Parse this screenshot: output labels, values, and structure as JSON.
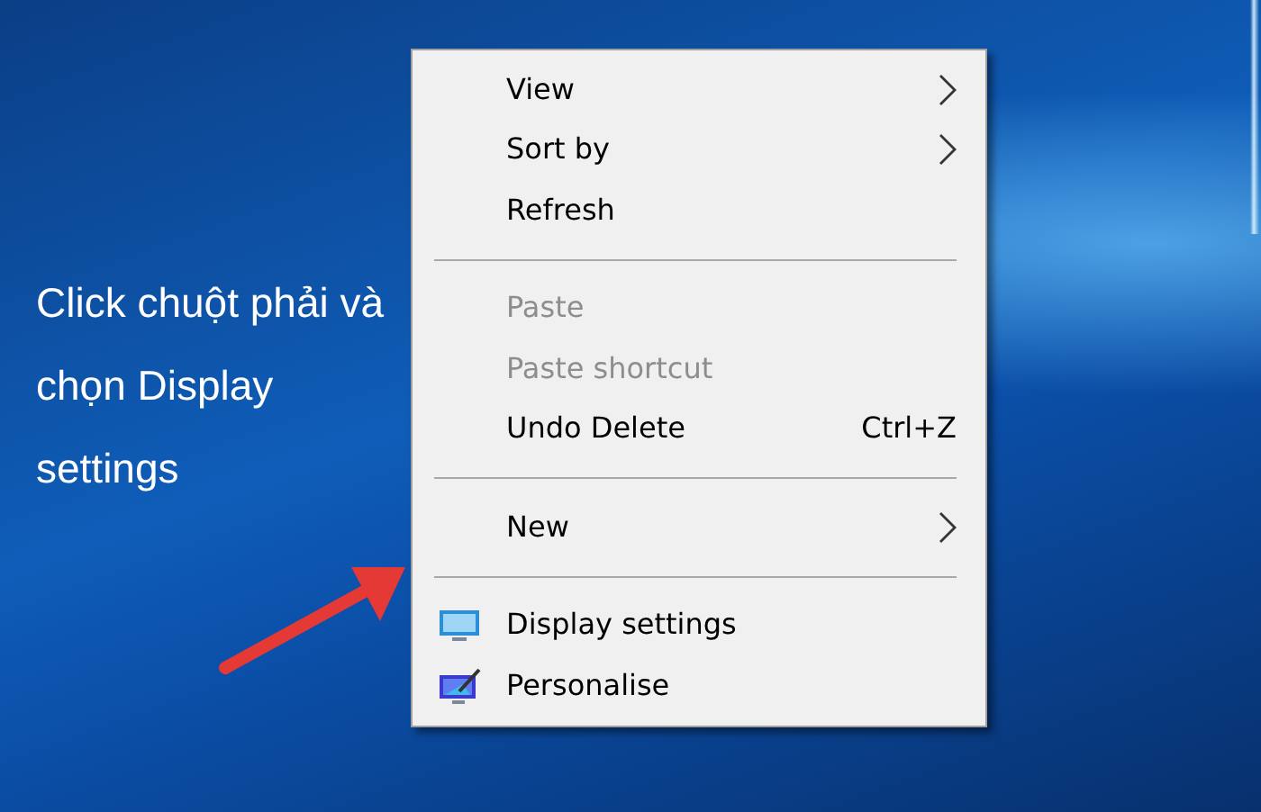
{
  "caption": "Click chuột phải và chọn Display settings",
  "menu": {
    "items": [
      {
        "kind": "submenu",
        "label": "View",
        "disabled": false
      },
      {
        "kind": "submenu",
        "label": "Sort by",
        "disabled": false
      },
      {
        "kind": "command",
        "label": "Refresh",
        "disabled": false
      },
      {
        "kind": "separator"
      },
      {
        "kind": "command",
        "label": "Paste",
        "disabled": true
      },
      {
        "kind": "command",
        "label": "Paste shortcut",
        "disabled": true
      },
      {
        "kind": "command",
        "label": "Undo Delete",
        "disabled": false,
        "shortcut": "Ctrl+Z"
      },
      {
        "kind": "separator"
      },
      {
        "kind": "submenu",
        "label": "New",
        "disabled": false
      },
      {
        "kind": "separator"
      },
      {
        "kind": "monitor-command",
        "label": "Display settings",
        "disabled": false
      },
      {
        "kind": "paint-command",
        "label": "Personalise",
        "disabled": false
      }
    ]
  }
}
